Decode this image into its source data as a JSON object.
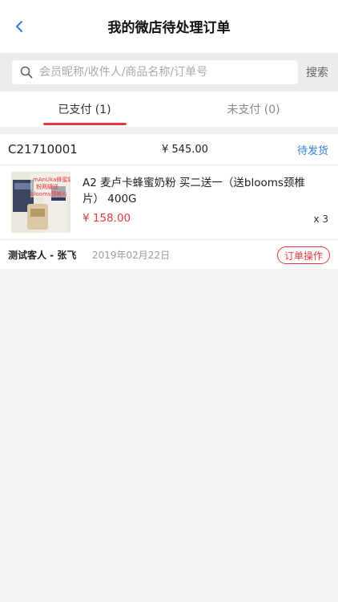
{
  "nav": {
    "title": "我的微店待处理订单"
  },
  "search": {
    "placeholder": "会员昵称/收件人/商品名称/订单号",
    "button": "搜索"
  },
  "tabs": [
    {
      "label": "已支付 (1)",
      "active": true
    },
    {
      "label": "未支付 (0)",
      "active": false
    }
  ],
  "order": {
    "number": "C21710001",
    "total": "¥ 545.00",
    "status": "待发货",
    "item": {
      "name": "A2 麦卢卡蜂蜜奶粉 买二送一（送blooms颈椎片） 400G",
      "price": "¥ 158.00",
      "qty": "x 3",
      "thumb_text": [
        "mAnUka蜂蜜奶",
        "粉两罐送",
        "blooms颈椎片"
      ]
    },
    "buyer": "测试客人 - 张飞",
    "date": "2019年02月22日",
    "action": "订单操作"
  },
  "colors": {
    "accent": "#e6393b",
    "link": "#2f7fd8",
    "back": "#2f7fd8"
  }
}
